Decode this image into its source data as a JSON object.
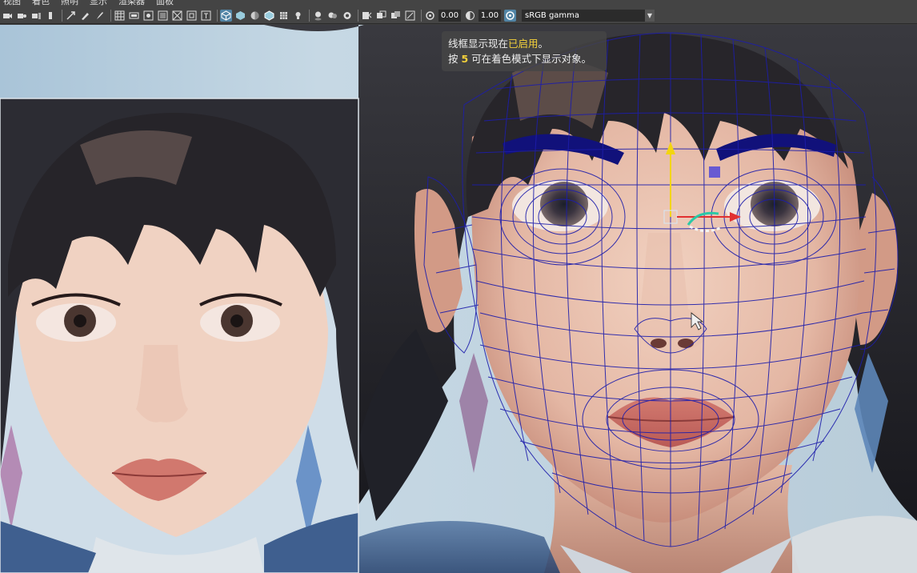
{
  "menu": [
    "视图",
    "着色",
    "照明",
    "显示",
    "渲染器",
    "面板"
  ],
  "toolbar": {
    "field_exposure": "0.00",
    "field_gamma": "1.00",
    "color_space": "sRGB gamma"
  },
  "hud": {
    "line1_prefix": "线框显示现在",
    "line1_highlight": "已启用",
    "line1_suffix": "。",
    "line2_prefix": "按 ",
    "line2_key": "5",
    "line2_suffix": " 可在着色模式下显示对象。"
  },
  "colors": {
    "wireframe": "#1d1dab",
    "toolbar_bg": "#444444",
    "active_tool": "#5285a6",
    "hud_highlight": "#f4d13a"
  }
}
